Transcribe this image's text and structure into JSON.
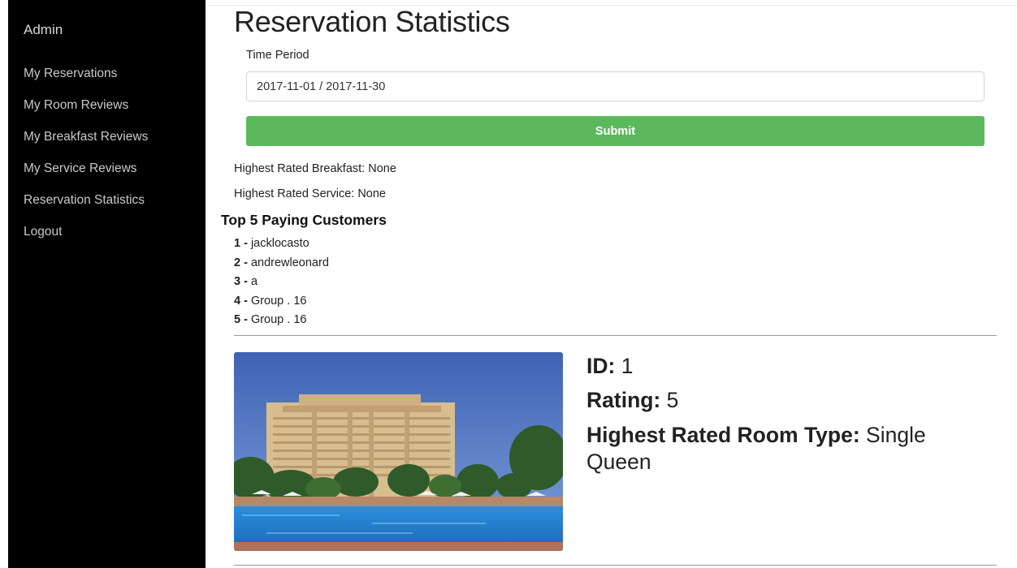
{
  "sidebar": {
    "brand": "Admin",
    "items": [
      {
        "label": "My Reservations"
      },
      {
        "label": "My Room Reviews"
      },
      {
        "label": "My Breakfast Reviews"
      },
      {
        "label": "My Service Reviews"
      },
      {
        "label": "Reservation Statistics"
      },
      {
        "label": "Logout"
      }
    ]
  },
  "main": {
    "title": "Reservation Statistics",
    "time_period": {
      "label": "Time Period",
      "value": "2017-11-01 / 2017-11-30"
    },
    "submit_label": "Submit",
    "highest_breakfast": "Highest Rated Breakfast: None",
    "highest_service": "Highest Rated Service: None",
    "top_customers": {
      "heading": "Top 5 Paying Customers",
      "items": [
        {
          "rank": "1 -",
          "name": " jacklocasto"
        },
        {
          "rank": "2 -",
          "name": " andrewleonard"
        },
        {
          "rank": "3 -",
          "name": " a"
        },
        {
          "rank": "4 -",
          "name": " Group . 16"
        },
        {
          "rank": "5 -",
          "name": " Group . 16"
        }
      ]
    },
    "hotel": {
      "id_label": "ID:",
      "id_value": " 1",
      "rating_label": "Rating:",
      "rating_value": " 5",
      "room_type_label": "Highest Rated Room Type:",
      "room_type_value": " Single Queen"
    }
  },
  "colors": {
    "sidebar_bg": "#000000",
    "submit_bg": "#5cb85c",
    "sky": "#4a6fb8",
    "pool": "#2e8fd6",
    "building": "#d7b98a"
  }
}
